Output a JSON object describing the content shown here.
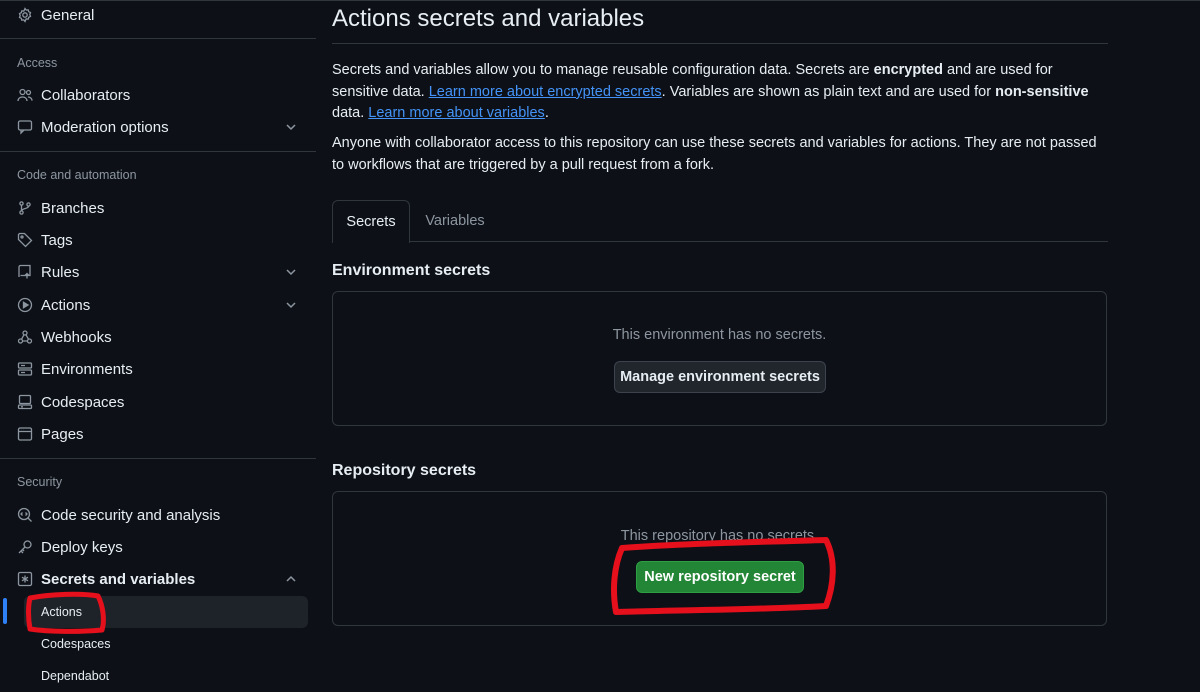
{
  "sidebar": {
    "general": "General",
    "sections": {
      "access": "Access",
      "code_automation": "Code and automation",
      "security": "Security"
    },
    "access_items": [
      "Collaborators",
      "Moderation options"
    ],
    "code_items": [
      "Branches",
      "Tags",
      "Rules",
      "Actions",
      "Webhooks",
      "Environments",
      "Codespaces",
      "Pages"
    ],
    "security_items": [
      "Code security and analysis",
      "Deploy keys",
      "Secrets and variables"
    ],
    "sub_items": [
      "Actions",
      "Codespaces",
      "Dependabot"
    ]
  },
  "main": {
    "title": "Actions secrets and variables",
    "intro": {
      "t1": "Secrets and variables allow you to manage reusable configuration data. Secrets are ",
      "b1": "encrypted",
      "t2": " and are used for sensitive data. ",
      "link1": "Learn more about encrypted secrets",
      "t3": ". Variables are shown as plain text and are used for ",
      "b2": "non-sensitive",
      "t4": " data. ",
      "link2": "Learn more about variables",
      "t5": "."
    },
    "access_note": "Anyone with collaborator access to this repository can use these secrets and variables for actions. They are not passed to workflows that are triggered by a pull request from a fork.",
    "tabs": [
      "Secrets",
      "Variables"
    ],
    "environment": {
      "heading": "Environment secrets",
      "empty": "This environment has no secrets.",
      "button": "Manage environment secrets"
    },
    "repository": {
      "heading": "Repository secrets",
      "empty": "This repository has no secrets.",
      "button": "New repository secret"
    }
  },
  "colors": {
    "background": "#0d1117",
    "border": "#30363d",
    "link": "#4493f8",
    "primary_button": "#238636",
    "active_indicator": "#2f81f7",
    "annotation": "#e5101b"
  }
}
